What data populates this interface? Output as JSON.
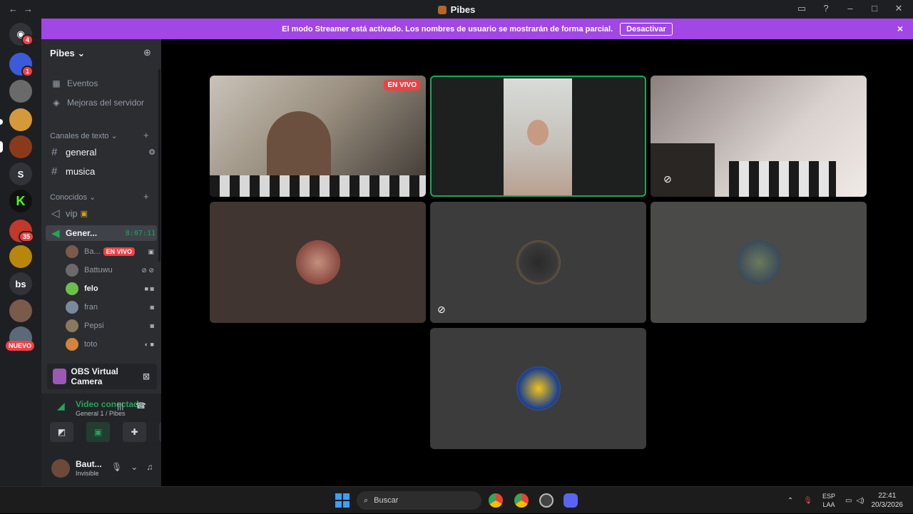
{
  "window": {
    "title": "Pibes",
    "nav_back": "←",
    "nav_fwd": "→"
  },
  "banner": {
    "text": "El modo Streamer está activado. Los nombres de usuario se mostrarán de forma parcial.",
    "button": "Desactivar",
    "close": "×"
  },
  "rail": {
    "home_badge": "4",
    "items": [
      {
        "label": "",
        "badge": "1"
      },
      {
        "label": ""
      },
      {
        "label": ""
      },
      {
        "label": ""
      },
      {
        "label": "S"
      },
      {
        "label": "K"
      },
      {
        "label": "",
        "badge": "35"
      },
      {
        "label": ""
      },
      {
        "label": "bs"
      },
      {
        "label": ""
      },
      {
        "label": ""
      }
    ],
    "nuevo": "NUEVO"
  },
  "server": {
    "name": "Pibes"
  },
  "sidebar": {
    "events": "Eventos",
    "boosts": "Mejoras del servidor",
    "text_category": "Canales de texto",
    "text_channels": [
      "general",
      "musica"
    ],
    "voice_category": "Conocidos",
    "vip": "vip",
    "voice_channel": "Gener...",
    "voice_timer": "8:07:11",
    "members": [
      {
        "name": "Ba...",
        "live": "EN VIVO"
      },
      {
        "name": "Battuwu"
      },
      {
        "name": "felo"
      },
      {
        "name": "fran"
      },
      {
        "name": "Pepsi"
      },
      {
        "name": "toto"
      }
    ]
  },
  "obs": {
    "label": "OBS Virtual Camera"
  },
  "voice": {
    "status": "Video conectado",
    "location": "General 1 / Pibes"
  },
  "user": {
    "name": "Baut...",
    "status": "Invisible"
  },
  "stage": {
    "live_tag": "EN VIVO"
  },
  "taskbar": {
    "search": "Buscar",
    "lang1": "ESP",
    "lang2": "LAA",
    "time": "22:41",
    "date": "20/3/2026"
  },
  "colors": {
    "accent": "#a047e5",
    "online": "#23a55a",
    "live": "#f23f43"
  }
}
